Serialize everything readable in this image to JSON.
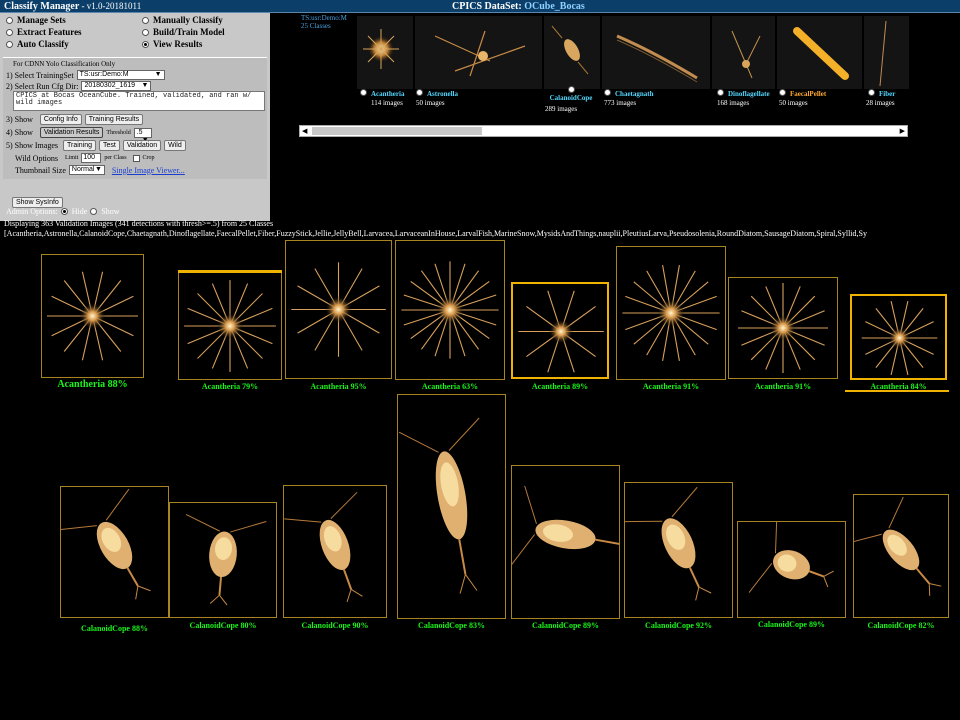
{
  "header": {
    "app_title": "Classify Manager",
    "version": " - v1.0-20181011",
    "dataset_label": "CPICS DataSet:",
    "dataset_name": "OCube_Bocas"
  },
  "menu": {
    "manage_sets": "Manage Sets",
    "manually_classify": "Manually Classify",
    "extract_features": "Extract Features",
    "build_train_model": "Build/Train Model",
    "auto_classify": "Auto Classify",
    "view_results": "View Results"
  },
  "cdnn": {
    "heading": "For CDNN Yolo Classification Only",
    "select_training_set_label": "1) Select TrainingSet",
    "training_set_value": "TS:usr:Demo:M",
    "select_run_dir_label": "2) Select Run Cfg Dir:",
    "run_dir_value": "20180302_1619",
    "description": "CPICS at Bocas OceanCube. Trained, validated, and ran w/ wild images",
    "show3_label": "3) Show",
    "config_info_btn": "Config Info",
    "training_results_btn": "Training Results",
    "show4_label": "4) Show",
    "validation_results_btn": "Validation Results",
    "threshold_label": "Threshold",
    "threshold_value": ".5",
    "show5_label": "5) Show Images",
    "training_btn": "Training",
    "test_btn": "Test",
    "validation_btn": "Validation",
    "wild_btn": "Wild",
    "wild_options_label": "Wild Options",
    "limit_label": "Limit",
    "limit_value": "100",
    "per_class_label": "per Class",
    "crop_label": "Crop",
    "thumbnail_size_label": "Thumbnail Size",
    "thumbnail_size_value": "Normal",
    "single_image_viewer_link": "Single Image Viewer..."
  },
  "show_sysinfo_btn": "Show SysInfo",
  "admin": {
    "label": "Admin Options:",
    "hide": "Hide",
    "show": "Show"
  },
  "training_set_panel": {
    "ts_name": "TS:usr:Demo:M",
    "class_count_label": "25 Classes",
    "classes": [
      {
        "name": "Acantheria",
        "count": "114 images"
      },
      {
        "name": "Astronella",
        "count": "50 images"
      },
      {
        "name": "CalanoidCope",
        "count": "289 images"
      },
      {
        "name": "Chaetagnath",
        "count": "773 images"
      },
      {
        "name": "Dinoflagellate",
        "count": "168 images"
      },
      {
        "name": "FaecalPellet",
        "count": "50 images"
      },
      {
        "name": "Fiber",
        "count": "28 images"
      }
    ],
    "scroll_left": "◀",
    "scroll_right": "▶"
  },
  "results": {
    "status": "Displaying 363 Validation Images (341 detections with thresh>=.5) from 25 Classes",
    "class_list": "[Acantheria,Astronella,CalanoidCope,Chaetagnath,Dinoflagellate,FaecalPellet,Fiber,FuzzyStick,Jellie,JellyBell,Larvacea,LarvaceanInHouse,LarvalFish,MarineSnow,MysidsAndThings,nauplii,PleutiusLarva,Pseudosolenia,RoundDiatom,SausageDiatom,Spiral,Syllid,Sy",
    "row1": [
      {
        "label": "Acantheria  88%"
      },
      {
        "label": "Acantheria  79%"
      },
      {
        "label": "Acantheria  95%"
      },
      {
        "label": "Acantheria  63%"
      },
      {
        "label": "Acantheria  89%"
      },
      {
        "label": "Acantheria  91%"
      },
      {
        "label": "Acantheria  91%"
      },
      {
        "label": "Acantheria  84%"
      }
    ],
    "row2": [
      {
        "label": "CalanoidCope  88%"
      },
      {
        "label": "CalanoidCope  80%"
      },
      {
        "label": "CalanoidCope  90%"
      },
      {
        "label": "CalanoidCope  83%"
      },
      {
        "label": "CalanoidCope  89%"
      },
      {
        "label": "CalanoidCope  92%"
      },
      {
        "label": "CalanoidCope  89%"
      },
      {
        "label": "CalanoidCope  82%"
      }
    ]
  }
}
